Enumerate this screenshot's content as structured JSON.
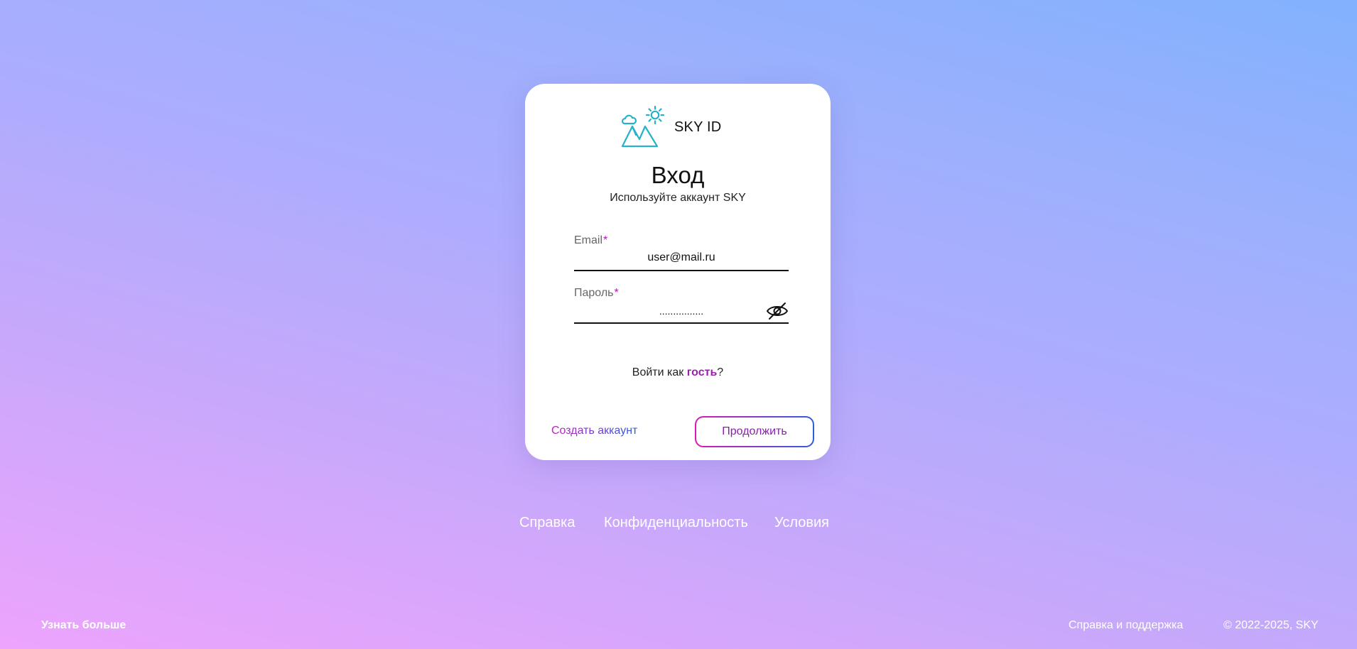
{
  "brand": {
    "name": "SKY ID",
    "logo_icon": "mountain-sun-cloud-icon",
    "logo_color": "#26b3c9"
  },
  "login": {
    "title": "Вход",
    "subtitle": "Используйте аккаунт SKY"
  },
  "email_field": {
    "label": "Email",
    "required_mark": "*",
    "value": "user@mail.ru"
  },
  "password_field": {
    "label": "Пароль",
    "required_mark": "*",
    "value": "................",
    "toggle_icon": "eye-off-icon"
  },
  "guest": {
    "prefix": "Войти как ",
    "link": "гость",
    "suffix": "?"
  },
  "actions": {
    "create_account": "Создать аккаунт",
    "continue": "Продолжить"
  },
  "footer_links": {
    "help": "Справка",
    "privacy": "Конфиденциальность",
    "terms": "Условия"
  },
  "bottom_bar": {
    "learn_more": "Узнать больше",
    "support": "Справка и поддержка",
    "copyright": "© 2022-2025, SKY"
  },
  "colors": {
    "accent_magenta": "#b01ab5",
    "accent_blue": "#2f5ed9",
    "background_start": "#eda4fd",
    "background_end": "#82b1fd"
  }
}
